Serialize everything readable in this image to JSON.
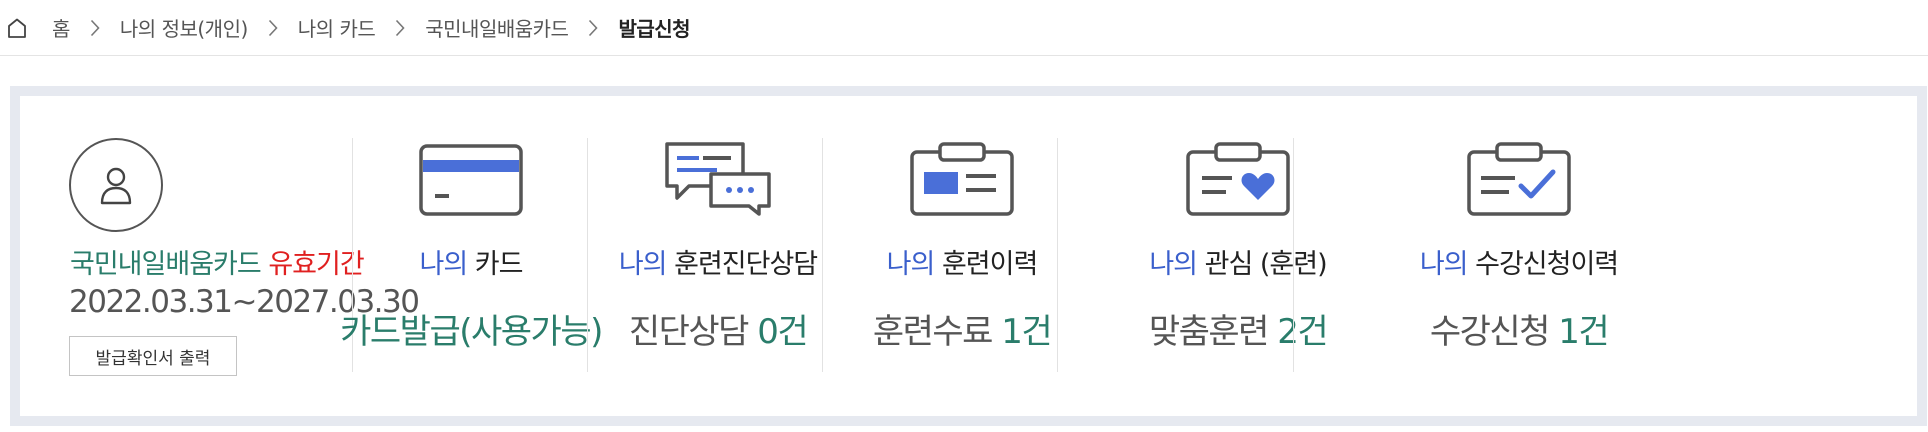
{
  "breadcrumb": {
    "home": "홈",
    "items": [
      "나의 정보(개인)",
      "나의 카드",
      "국민내일배움카드"
    ],
    "current": "발급신청"
  },
  "profile": {
    "card_name": "국민내일배움카드",
    "valid_label": "유효기간",
    "valid_dates": "2022.03.31~2027.03.30",
    "print_button": "발급확인서 출력"
  },
  "columns": [
    {
      "prefix": "나의",
      "title": "카드",
      "value_text": "카드발급(사용가능)",
      "icon": "credit-card-icon"
    },
    {
      "prefix": "나의",
      "title": "훈련진단상담",
      "value_text": "진단상담",
      "count": "0건",
      "icon": "chat-bubbles-icon"
    },
    {
      "prefix": "나의",
      "title": "훈련이력",
      "value_text": "훈련수료",
      "count": "1건",
      "icon": "id-card-icon"
    },
    {
      "prefix": "나의",
      "title": "관심 (훈련)",
      "value_text": "맞춤훈련",
      "count": "2건",
      "icon": "heart-badge-icon"
    },
    {
      "prefix": "나의",
      "title": "수강신청이력",
      "value_text": "수강신청",
      "count": "1건",
      "icon": "checklist-badge-icon"
    }
  ],
  "colors": {
    "accent_blue": "#3a5fcc",
    "accent_green": "#2a7d6b",
    "accent_red": "#e02020",
    "frame": "#e6e9f0"
  }
}
